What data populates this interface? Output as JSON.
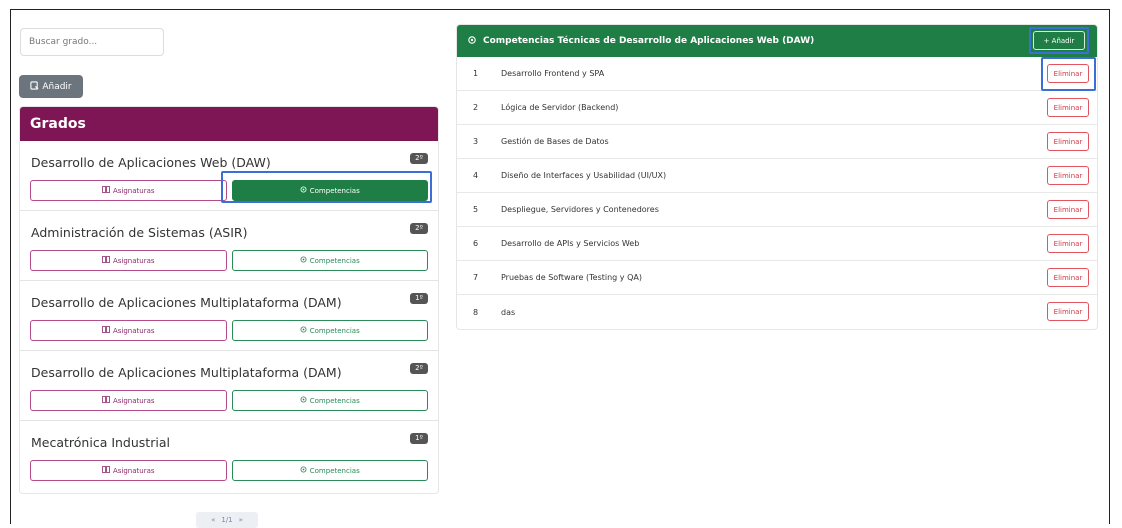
{
  "search": {
    "placeholder": "Buscar grado..."
  },
  "left": {
    "add_label": "Añadir",
    "card_title": "Grados",
    "grados": [
      {
        "title": "Desarrollo de Aplicaciones Web (DAW)",
        "course": "2º",
        "asig_label": "Asignaturas",
        "comp_label": "Competencias",
        "active": true
      },
      {
        "title": "Administración de Sistemas (ASIR)",
        "course": "2º",
        "asig_label": "Asignaturas",
        "comp_label": "Competencias",
        "active": false
      },
      {
        "title": "Desarrollo de Aplicaciones Multiplataforma (DAM)",
        "course": "1º",
        "asig_label": "Asignaturas",
        "comp_label": "Competencias",
        "active": false
      },
      {
        "title": "Desarrollo de Aplicaciones Multiplataforma (DAM)",
        "course": "2º",
        "asig_label": "Asignaturas",
        "comp_label": "Competencias",
        "active": false
      },
      {
        "title": "Mecatrónica Industrial",
        "course": "1º",
        "asig_label": "Asignaturas",
        "comp_label": "Competencias",
        "active": false
      }
    ],
    "pager": {
      "prev": "«",
      "page": "1/1",
      "next": "»"
    }
  },
  "right": {
    "title": "Competencias Técnicas de Desarrollo de Aplicaciones Web (DAW)",
    "add_label": "+ Añadir",
    "delete_label": "Eliminar",
    "items": [
      {
        "num": "1",
        "label": "Desarrollo Frontend y SPA"
      },
      {
        "num": "2",
        "label": "Lógica de Servidor (Backend)"
      },
      {
        "num": "3",
        "label": "Gestión de Bases de Datos"
      },
      {
        "num": "4",
        "label": "Diseño de Interfaces y Usabilidad (UI/UX)"
      },
      {
        "num": "5",
        "label": "Despliegue, Servidores y Contenedores"
      },
      {
        "num": "6",
        "label": "Desarrollo de APIs y Servicios Web"
      },
      {
        "num": "7",
        "label": "Pruebas de Software (Testing y QA)"
      },
      {
        "num": "8",
        "label": "das"
      }
    ]
  },
  "colors": {
    "brand_purple": "#7e1656",
    "brand_green": "#1f7e45",
    "danger": "#d33a45",
    "focus": "#3b6fd6"
  }
}
